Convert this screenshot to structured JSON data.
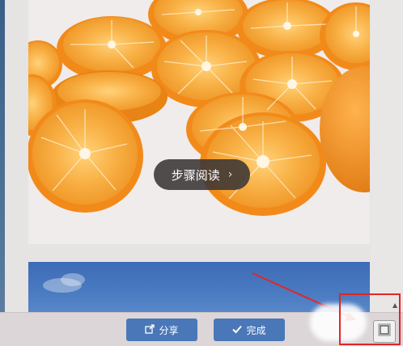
{
  "step_read": {
    "label": "步骤阅读",
    "chevron": "›"
  },
  "toolbar": {
    "share_label": "分享",
    "done_label": "完成",
    "share_icon": "share-icon",
    "done_icon": "checkmark-icon"
  },
  "fullscreen": {
    "icon": "fullscreen-icon"
  },
  "colors": {
    "accent": "#4a77b8",
    "annotation": "#e02626"
  }
}
